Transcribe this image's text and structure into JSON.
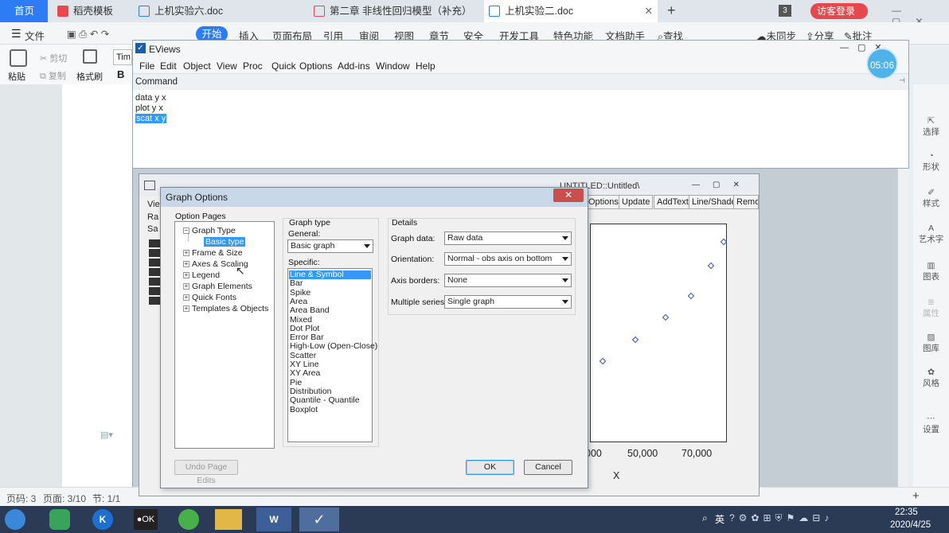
{
  "wps": {
    "tabs": [
      {
        "label": "首页"
      },
      {
        "label": "稻壳模板"
      },
      {
        "label": "上机实验六.doc"
      },
      {
        "label": "第二章 非线性回归模型（补充）"
      },
      {
        "label": "上机实验二.doc"
      }
    ],
    "tab_count_badge": "3",
    "visitor_login": "访客登录",
    "menu": [
      "文件",
      "开始",
      "插入",
      "页面布局",
      "引用",
      "审阅",
      "视图",
      "章节",
      "安全",
      "开发工具",
      "特色功能",
      "文档助手",
      "查找"
    ],
    "sync": "未同步",
    "share": "分享",
    "comment": "批注",
    "toolbar": {
      "cut": "剪切",
      "copy": "复制",
      "paste": "粘贴",
      "format_painter": "格式刷",
      "font_box": "Tim"
    },
    "right_panel": [
      "选择",
      "形状",
      "样式",
      "艺术字",
      "图表",
      "属性",
      "图库",
      "风格",
      "设置"
    ],
    "status": {
      "page_count": "页码: 3",
      "page": "页面: 3/10",
      "section": "节: 1/1"
    }
  },
  "taskbar": {
    "tray_lang": "英",
    "time": "22:35",
    "date": "2020/4/25"
  },
  "eviews": {
    "title": "EViews",
    "menu": [
      "File",
      "Edit",
      "Object",
      "View",
      "Proc",
      "Quick",
      "Options",
      "Add-ins",
      "Window",
      "Help"
    ],
    "command_label": "Command",
    "commands": [
      "data  y x",
      "plot y x",
      "scat x y"
    ],
    "clock": "05:06"
  },
  "graph_window": {
    "title_partial": "UNTITLED::Untitled\\",
    "buttons": [
      "Options",
      "Update",
      "AddText",
      "Line/Shade",
      "Remo"
    ],
    "left_labels": [
      "Vie",
      "Ra",
      "Sa"
    ]
  },
  "chart_data": {
    "type": "scatter",
    "xlabel": "X",
    "x_ticks": [
      "000",
      "50,000",
      "70,000"
    ],
    "points": [
      [
        0.09,
        0.63
      ],
      [
        0.33,
        0.53
      ],
      [
        0.55,
        0.43
      ],
      [
        0.74,
        0.33
      ],
      [
        0.89,
        0.19
      ],
      [
        0.98,
        0.08
      ]
    ]
  },
  "dialog": {
    "title": "Graph Options",
    "option_pages_label": "Option Pages",
    "tree": [
      {
        "label": "Graph Type",
        "expanded": true,
        "children": [
          "Basic type"
        ]
      },
      {
        "label": "Frame & Size"
      },
      {
        "label": "Axes & Scaling"
      },
      {
        "label": "Legend"
      },
      {
        "label": "Graph Elements"
      },
      {
        "label": "Quick Fonts"
      },
      {
        "label": "Templates & Objects"
      }
    ],
    "graph_type_label": "Graph type",
    "general_label": "General:",
    "general_value": "Basic graph",
    "specific_label": "Specific:",
    "specific_items": [
      "Line & Symbol",
      "Bar",
      "Spike",
      "Area",
      "Area Band",
      "Mixed",
      "Dot Plot",
      "Error Bar",
      "High-Low (Open-Close)",
      "Scatter",
      "XY Line",
      "XY Area",
      "Pie",
      "Distribution",
      "Quantile - Quantile",
      "Boxplot"
    ],
    "details_label": "Details",
    "graph_data_label": "Graph data:",
    "graph_data_value": "Raw data",
    "orientation_label": "Orientation:",
    "orientation_value": "Normal - obs axis on bottom",
    "axis_borders_label": "Axis borders:",
    "axis_borders_value": "None",
    "multiple_series_label": "Multiple series:",
    "multiple_series_value": "Single graph",
    "undo_label": "Undo Page Edits",
    "ok_label": "OK",
    "cancel_label": "Cancel"
  },
  "colors": {
    "accent": "#2d7cf6",
    "selection": "#3399ff",
    "danger": "#e5484d"
  }
}
